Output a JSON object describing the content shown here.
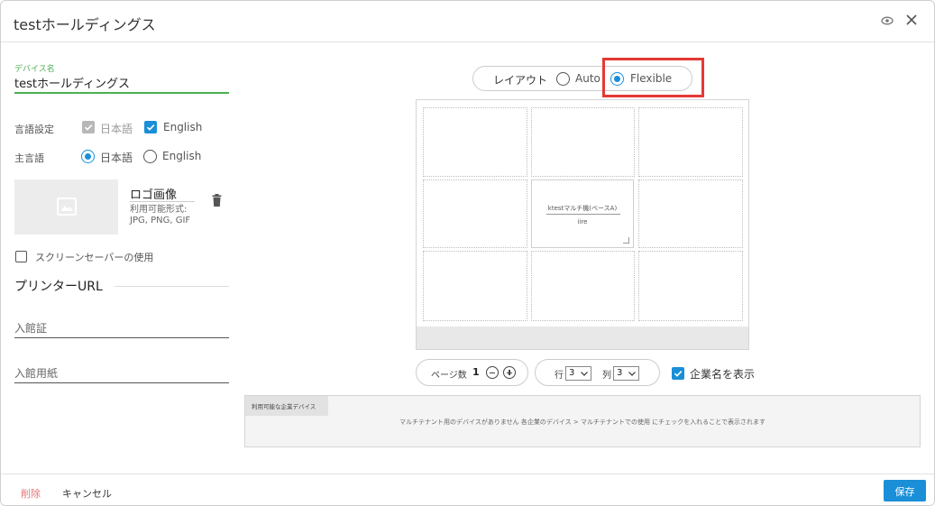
{
  "dialog": {
    "title": "testホールディングス"
  },
  "left": {
    "device_name_label": "デバイス名",
    "device_name_value": "testホールディングス",
    "language_setting_label": "言語設定",
    "language_options": [
      {
        "label": "日本語",
        "checked": true,
        "disabled": true
      },
      {
        "label": "English",
        "checked": true,
        "disabled": false
      }
    ],
    "main_language_label": "主言語",
    "main_language_options": [
      {
        "label": "日本語",
        "selected": true
      },
      {
        "label": "English",
        "selected": false
      }
    ],
    "logo_title": "ロゴ画像",
    "logo_formats_label": "利用可能形式:",
    "logo_formats": "JPG, PNG, GIF",
    "screensaver_label": "スクリーンセーバーの使用",
    "screensaver_checked": false,
    "printer_section_title": "プリンターURL",
    "printer_fields": [
      {
        "placeholder": "入館証"
      },
      {
        "placeholder": "入館用紙"
      }
    ]
  },
  "layout": {
    "label": "レイアウト",
    "options": [
      {
        "label": "Auto",
        "selected": false
      },
      {
        "label": "Flexible",
        "selected": true
      }
    ]
  },
  "grid": {
    "rows": 3,
    "cols": 3,
    "card": {
      "title": "ktestマルチ機(ベースA)",
      "subtitle": "iire"
    }
  },
  "pagination": {
    "label": "ページ数",
    "value": "1"
  },
  "rowcol": {
    "row_label": "行",
    "row_value": "3",
    "col_label": "列",
    "col_value": "3"
  },
  "company_name": {
    "label": "企業名を表示",
    "checked": true
  },
  "available_devices": {
    "tab_label": "利用可能な企業デバイス",
    "message": "マルチテナント用のデバイスがありません 各企業のデバイス > マルチテナントでの使用 にチェックを入れることで表示されます"
  },
  "footer": {
    "delete_label": "削除",
    "cancel_label": "キャンセル",
    "save_label": "保存"
  },
  "colors": {
    "accent": "#1a8fd8",
    "highlight": "#e53935",
    "field_focus": "#4caf50",
    "delete": "#e57373"
  },
  "icons": [
    "eye-icon",
    "close-icon",
    "image-icon",
    "trash-icon",
    "minus-circle-icon",
    "plus-circle-icon",
    "chevron-down-icon",
    "check-icon"
  ]
}
